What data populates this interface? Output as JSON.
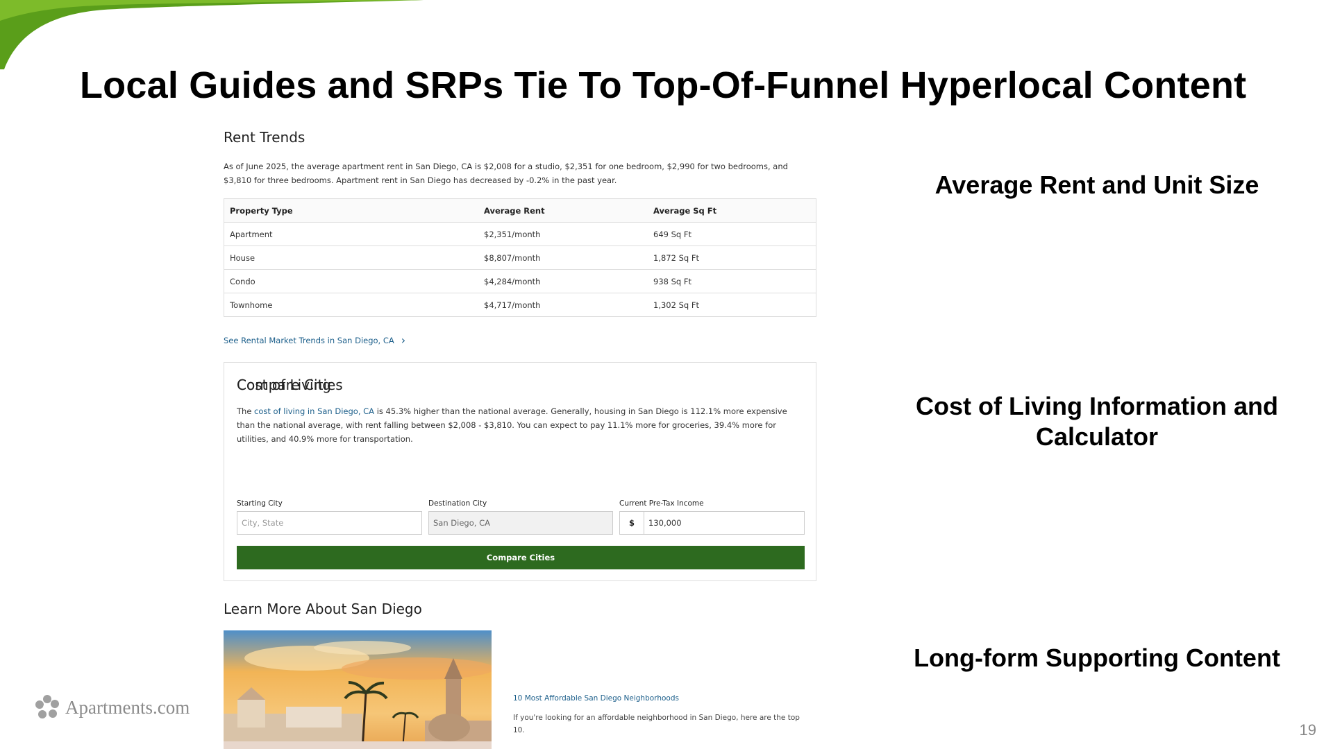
{
  "slide": {
    "title": "Local Guides and SRPs Tie To Top-Of-Funnel Hyperlocal Content",
    "page_number": "19",
    "logo_text": "Apartments.com",
    "accent_color": "#5a9e1a"
  },
  "labels": {
    "rent": "Average Rent and Unit Size",
    "col": "Cost of Living Information and Calculator",
    "long": "Long-form Supporting Content"
  },
  "rent_trends": {
    "heading": "Rent Trends",
    "paragraph": "As of June 2025, the average apartment rent in San Diego, CA is $2,008 for a studio, $2,351 for one bedroom, $2,990 for two bedrooms, and $3,810 for three bedrooms. Apartment rent in San Diego has decreased by -0.2% in the past year.",
    "columns": [
      "Property Type",
      "Average Rent",
      "Average Sq Ft"
    ],
    "rows": [
      [
        "Apartment",
        "$2,351/month",
        "649 Sq Ft"
      ],
      [
        "House",
        "$8,807/month",
        "1,872 Sq Ft"
      ],
      [
        "Condo",
        "$4,284/month",
        "938 Sq Ft"
      ],
      [
        "Townhome",
        "$4,717/month",
        "1,302 Sq Ft"
      ]
    ],
    "link": "See Rental Market Trends in San Diego, CA"
  },
  "cost_of_living": {
    "heading": "Cost of Living",
    "p_pre": "The ",
    "p_link": "cost of living in San Diego, CA",
    "p_post": " is 45.3% higher than the national average. Generally, housing in San Diego is 112.1% more expensive than the national average, with rent falling between $2,008 - $3,810. You can expect to pay 11.1% more for groceries, 39.4% more for utilities, and 40.9% more for transportation.",
    "compare_heading": "Compare Cities",
    "starting_label": "Starting City",
    "starting_placeholder": "City, State",
    "destination_label": "Destination City",
    "destination_value": "San Diego, CA",
    "income_label": "Current Pre-Tax Income",
    "currency": "$",
    "income_value": "130,000",
    "button": "Compare Cities",
    "button_color": "#2d6a1f"
  },
  "learn_more": {
    "heading": "Learn More About San Diego",
    "article_title": "10 Most Affordable San Diego Neighborhoods",
    "article_desc": "If you're looking for an affordable neighborhood in San Diego, here are the top 10."
  }
}
